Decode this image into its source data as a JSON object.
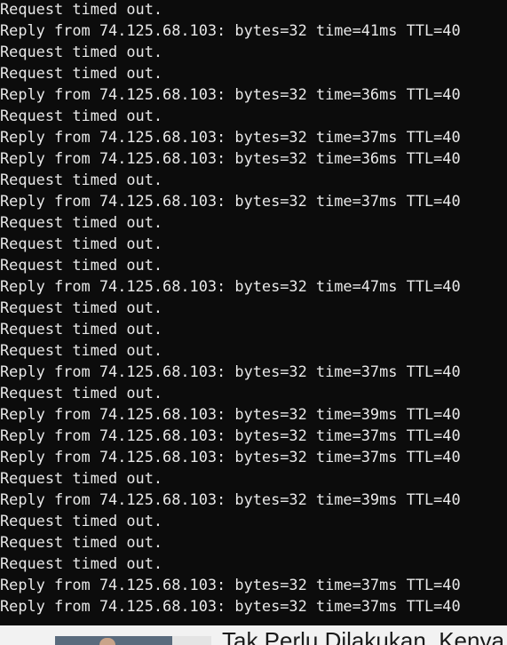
{
  "console": {
    "lines": [
      "Request timed out.",
      "Reply from 74.125.68.103: bytes=32 time=41ms TTL=40",
      "Request timed out.",
      "Request timed out.",
      "Reply from 74.125.68.103: bytes=32 time=36ms TTL=40",
      "Request timed out.",
      "Reply from 74.125.68.103: bytes=32 time=37ms TTL=40",
      "Reply from 74.125.68.103: bytes=32 time=36ms TTL=40",
      "Request timed out.",
      "Reply from 74.125.68.103: bytes=32 time=37ms TTL=40",
      "Request timed out.",
      "Request timed out.",
      "Request timed out.",
      "Reply from 74.125.68.103: bytes=32 time=47ms TTL=40",
      "Request timed out.",
      "Request timed out.",
      "Request timed out.",
      "Reply from 74.125.68.103: bytes=32 time=37ms TTL=40",
      "Request timed out.",
      "Reply from 74.125.68.103: bytes=32 time=39ms TTL=40",
      "Reply from 74.125.68.103: bytes=32 time=37ms TTL=40",
      "Reply from 74.125.68.103: bytes=32 time=37ms TTL=40",
      "Request timed out.",
      "Reply from 74.125.68.103: bytes=32 time=39ms TTL=40",
      "Request timed out.",
      "Request timed out.",
      "Request timed out.",
      "Reply from 74.125.68.103: bytes=32 time=37ms TTL=40",
      "Reply from 74.125.68.103: bytes=32 time=37ms TTL=40"
    ],
    "text_color": "#e8e8e8",
    "background_color": "#0c0c0c"
  },
  "page_behind": {
    "headline": "Tak Perlu Dilakukan, Kenya"
  }
}
